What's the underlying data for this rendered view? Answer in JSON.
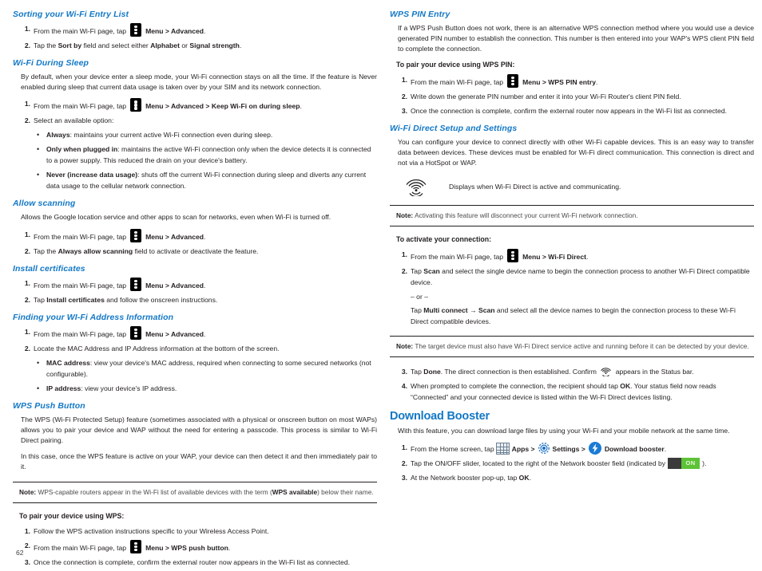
{
  "page": {
    "number": "62",
    "accent_color": "#1378c6",
    "text_color": "#231f20"
  },
  "icons": {
    "menu": "menu-overflow-icon",
    "wifi_direct": "wifi-direct-icon",
    "apps": "apps-grid-icon",
    "settings": "settings-gear-icon",
    "download_booster": "download-booster-icon",
    "toggle_on_label": "ON"
  },
  "left_column": {
    "sections": [
      {
        "heading": "Sorting your Wi-Fi Entry List",
        "steps": [
          {
            "num": "1.",
            "pre": "From the main Wi-Fi page, tap",
            "icon": "menu",
            "post_bold": "Menu > Advanced",
            "post_tail": "."
          },
          {
            "num": "2.",
            "text_parts": [
              "Tap the ",
              "Sort by",
              " field and select either ",
              "Alphabet",
              " or ",
              "Signal strength",
              "."
            ]
          }
        ]
      },
      {
        "heading": "Wi-Fi During Sleep",
        "paragraph": "By default, when your device enter a sleep mode, your Wi-Fi connection stays on all the time. If the feature is Never enabled during sleep that current data usage is taken over by your SIM and its network connection.",
        "steps": [
          {
            "num": "1.",
            "pre": "From the main Wi-Fi page, tap",
            "icon": "menu",
            "post_bold": "Menu > Advanced > Keep Wi-Fi on during sleep",
            "post_tail": "."
          },
          {
            "num": "2.",
            "text": "Select an available option:"
          }
        ],
        "bullets": [
          {
            "bold": "Always",
            "rest": ": maintains your current active Wi-Fi connection even during sleep."
          },
          {
            "bold": "Only when plugged in",
            "rest": ": maintains the active Wi-Fi connection only when the device detects it is connected to a power supply. This reduced the drain on your device's battery."
          },
          {
            "bold": "Never (increase data usage)",
            "rest": ": shuts off the current Wi-Fi connection during sleep and diverts any current data usage to the cellular network connection."
          }
        ]
      },
      {
        "heading": "Allow scanning",
        "paragraph": "Allows the Google location service and other apps to scan for networks, even when Wi-Fi is turned off.",
        "steps": [
          {
            "num": "1.",
            "pre": "From the main Wi-Fi page, tap",
            "icon": "menu",
            "post_bold": "Menu > Advanced",
            "post_tail": "."
          },
          {
            "num": "2.",
            "text_parts": [
              "Tap the ",
              "Always allow scanning",
              " field to activate or deactivate the feature."
            ]
          }
        ]
      },
      {
        "heading": "Install certificates",
        "steps": [
          {
            "num": "1.",
            "pre": "From the main Wi-Fi page, tap",
            "icon": "menu",
            "post_bold": "Menu > Advanced",
            "post_tail": "."
          },
          {
            "num": "2.",
            "text_parts": [
              "Tap ",
              "Install certificates",
              " and follow the onscreen instructions."
            ]
          }
        ]
      },
      {
        "heading": "Finding your WI-Fi Address Information",
        "steps": [
          {
            "num": "1.",
            "pre": "From the main Wi-Fi page, tap",
            "icon": "menu",
            "post_bold": "Menu > Advanced",
            "post_tail": "."
          },
          {
            "num": "2.",
            "text": "Locate the MAC Address and IP Address information at the bottom of the screen."
          }
        ],
        "bullets": [
          {
            "bold": "MAC address",
            "rest": ": view your device's MAC address, required when connecting to some secured networks (not configurable)."
          },
          {
            "bold": "IP address",
            "rest": ": view your device's IP address."
          }
        ]
      },
      {
        "heading": "WPS Push Button",
        "paragraph": "The WPS (Wi-Fi Protected Setup) feature (sometimes associated with a physical or onscreen button on most WAPs) allows you to pair your device and WAP without the need for entering a passcode. This process is similar to Wi-Fi Direct pairing.",
        "paragraph2": "In this case, once the WPS feature is active on your WAP, your device can then detect it and then immediately pair to it.",
        "note": {
          "label": "Note:",
          "text_a": "WPS-capable routers appear in the Wi-Fi list of available devices with the term (",
          "text_bold": "WPS available",
          "text_b": ") below their name."
        },
        "subhead": "To pair your device using WPS:",
        "steps2": [
          {
            "num": "1.",
            "text": "Follow the WPS activation instructions specific to your Wireless Access Point."
          },
          {
            "num": "2.",
            "pre": "From the main Wi-Fi page, tap",
            "icon": "menu",
            "post_bold": "Menu > WPS push button",
            "post_tail": "."
          },
          {
            "num": "3.",
            "text": "Once the connection is complete, confirm the external router now appears in the Wi-Fi list as connected."
          }
        ]
      }
    ]
  },
  "right_column": {
    "sections": [
      {
        "heading": "WPS PIN Entry",
        "paragraph": "If a WPS Push Button does not work, there is an alternative WPS connection method where you would use a device generated PIN number to establish the connection. This number is then entered into your WAP's WPS client PIN field to complete the connection.",
        "subhead": "To pair your device using WPS PIN:",
        "steps": [
          {
            "num": "1.",
            "pre": "From the main Wi-Fi page, tap",
            "icon": "menu",
            "post_bold": "Menu > WPS PIN entry",
            "post_tail": "."
          },
          {
            "num": "2.",
            "text": "Write down the generate PIN number and enter it into your Wi-Fi Router's client PIN field."
          },
          {
            "num": "3.",
            "text": "Once the connection is complete, confirm the external router now appears in the Wi-Fi list as connected."
          }
        ]
      },
      {
        "heading": "Wi-Fi Direct Setup and Settings",
        "paragraph": "You can configure your device to connect directly with other Wi-Fi capable devices. This is an easy way to transfer data between devices. These devices must be enabled for Wi-Fi direct communication. This connection is direct and not via a HotSpot or WAP.",
        "icon_caption": "Displays when Wi-Fi Direct is active and communicating.",
        "note": {
          "label": "Note:",
          "text_a": "Activating this feature will disconnect your current Wi-Fi network connection."
        },
        "subhead": "To activate your connection:",
        "steps": [
          {
            "num": "1.",
            "pre": "From the main Wi-Fi page, tap",
            "icon": "menu",
            "post_bold": "Menu > Wi-Fi Direct",
            "post_tail": "."
          },
          {
            "num": "2.",
            "parts": [
              "Tap ",
              "Scan",
              " and select the single device name to begin the connection process to another Wi-Fi Direct compatible device."
            ]
          }
        ],
        "or_text": "– or –",
        "or_step": [
          "Tap ",
          "Multi connect → Scan",
          " and select all the device names to begin the connection process to these Wi-Fi Direct compatible devices."
        ],
        "note2": {
          "label": "Note:",
          "text_a": "The target device must also have Wi-Fi Direct service active and running before it can be detected by your device."
        },
        "steps_after": [
          {
            "num": "3.",
            "parts_a": [
              "Tap ",
              "Done",
              ". The direct connection is then established. Confirm "
            ],
            "icon": "wifi_direct",
            "parts_b": [
              " appears in the Status bar."
            ]
          },
          {
            "num": "4.",
            "parts_a": [
              "When prompted to complete the connection, the recipient should tap ",
              "OK",
              ". Your status field now reads “Connected” and your connected device is listed within the Wi-Fi Direct devices listing."
            ]
          }
        ]
      },
      {
        "big_heading": "Download Booster",
        "paragraph": "With this feature, you can download large files by using your Wi-Fi and your mobile network at the same time.",
        "steps": [
          {
            "num": "1.",
            "pre": "From the Home screen, tap",
            "apps_label": "Apps >",
            "settings_label": "Settings >",
            "booster_label": "Download booster",
            "tail": "."
          },
          {
            "num": "2.",
            "pre": "Tap the ON/OFF slider, located to the right of the Network booster field (indicated by",
            "tail": ")."
          },
          {
            "num": "3.",
            "parts": [
              "At the Network booster pop-up, tap ",
              "OK",
              "."
            ]
          }
        ]
      }
    ]
  }
}
